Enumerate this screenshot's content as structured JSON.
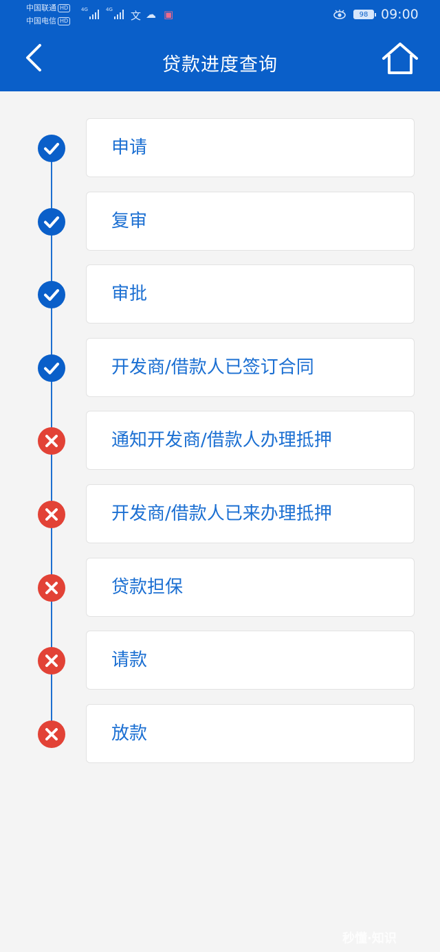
{
  "status_bar": {
    "carrier_1": "中国联通",
    "carrier_2": "中国电信",
    "hd_badge": "HD",
    "network_1": "4G",
    "network_2": "4G",
    "wen_glyph": "文",
    "battery": "98",
    "time": "09:00"
  },
  "header": {
    "title": "贷款进度查询",
    "back_icon": "chevron-left-icon",
    "home_icon": "home-icon"
  },
  "steps": [
    {
      "label": "申请",
      "status": "done"
    },
    {
      "label": "复审",
      "status": "done"
    },
    {
      "label": "审批",
      "status": "done"
    },
    {
      "label": "开发商/借款人已签订合同",
      "status": "done"
    },
    {
      "label": "通知开发商/借款人办理抵押",
      "status": "fail"
    },
    {
      "label": "开发商/借款人已来办理抵押",
      "status": "fail"
    },
    {
      "label": "贷款担保",
      "status": "fail"
    },
    {
      "label": "请款",
      "status": "fail"
    },
    {
      "label": "放款",
      "status": "fail"
    }
  ],
  "colors": {
    "primary": "#0a5fc9",
    "done": "#0a5fc9",
    "fail": "#e24236",
    "label_text": "#1b6fd2"
  },
  "watermark": "秒懂·知识"
}
